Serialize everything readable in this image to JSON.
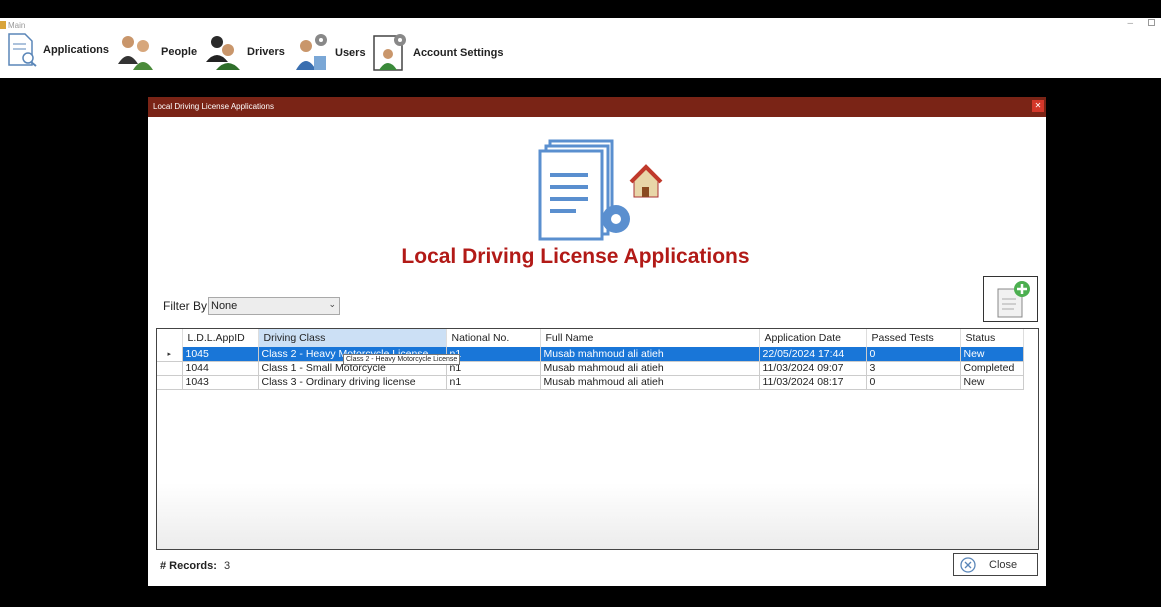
{
  "window": {
    "title": "Main"
  },
  "menu": {
    "items": [
      {
        "label": "Applications",
        "icon": "document-search-icon"
      },
      {
        "label": "People",
        "icon": "people-icon"
      },
      {
        "label": "Drivers",
        "icon": "drivers-icon"
      },
      {
        "label": "Users",
        "icon": "users-icon"
      },
      {
        "label": "Account Settings",
        "icon": "account-settings-icon"
      }
    ]
  },
  "dialog": {
    "title": "Local Driving License Applications",
    "heading": "Local Driving License Applications",
    "filter": {
      "label": "Filter By:",
      "value": "None"
    },
    "grid": {
      "columns": [
        "L.D.L.AppID",
        "Driving Class",
        "National No.",
        "Full Name",
        "Application Date",
        "Passed Tests",
        "Status"
      ],
      "rows": [
        [
          "1045",
          "Class 2 - Heavy Motorcycle License",
          "n1",
          "Musab mahmoud ali atieh",
          "22/05/2024 17:44",
          "0",
          "New"
        ],
        [
          "1044",
          "Class 1 - Small Motorcycle",
          "n1",
          "Musab mahmoud ali atieh",
          "11/03/2024 09:07",
          "3",
          "Completed"
        ],
        [
          "1043",
          "Class 3 - Ordinary driving license",
          "n1",
          "Musab mahmoud ali atieh",
          "11/03/2024 08:17",
          "0",
          "New"
        ]
      ],
      "tooltip": "Class 2 - Heavy Motorcycle License"
    },
    "records_label": "# Records:",
    "records_count": "3",
    "close_label": "Close"
  },
  "colors": {
    "title_bar": "#7a2416",
    "heading": "#b21a17",
    "selection": "#1976d8"
  }
}
